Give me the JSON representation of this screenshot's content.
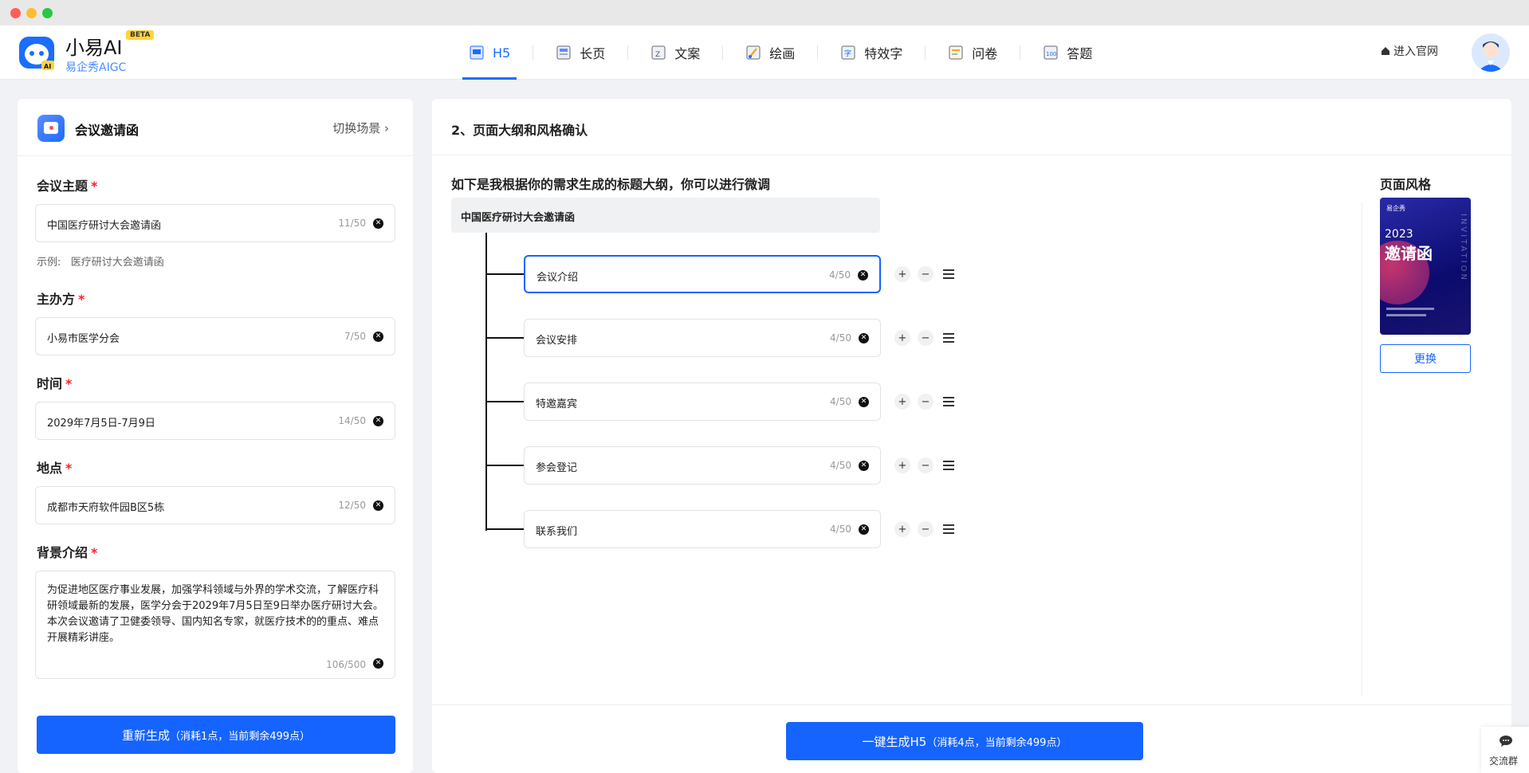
{
  "app": {
    "name": "小易AI",
    "badge": "BETA",
    "subtitle": "易企秀AIGC"
  },
  "nav": {
    "tabs": [
      {
        "label": "H5",
        "icon": "h5-icon",
        "active": true
      },
      {
        "label": "长页",
        "icon": "long-page-icon"
      },
      {
        "label": "文案",
        "icon": "copywriting-icon"
      },
      {
        "label": "绘画",
        "icon": "painting-icon"
      },
      {
        "label": "特效字",
        "icon": "effect-text-icon"
      },
      {
        "label": "问卷",
        "icon": "survey-icon"
      },
      {
        "label": "答题",
        "icon": "quiz-icon"
      }
    ],
    "site_link": "进入官网"
  },
  "left": {
    "scene_title": "会议邀请函",
    "switch_label": "切换场景",
    "fields": [
      {
        "label": "会议主题",
        "value": "中国医疗研讨大会邀请函",
        "count": "11/50"
      },
      {
        "label": "主办方",
        "value": "小易市医学分会",
        "count": "7/50"
      },
      {
        "label": "时间",
        "value": "2029年7月5日-7月9日",
        "count": "14/50"
      },
      {
        "label": "地点",
        "value": "成都市天府软件园B区5栋",
        "count": "12/50"
      }
    ],
    "required_mark": "*",
    "example_label": "示例:",
    "example_text": "医疗研讨大会邀请函",
    "background": {
      "label": "背景介绍",
      "value": "为促进地区医疗事业发展，加强学科领域与外界的学术交流，了解医疗科研领域最新的发展，医学分会于2029年7月5日至9日举办医疗研讨大会。本次会议邀请了卫健委领导、国内知名专家，就医疗技术的的重点、难点开展精彩讲座。",
      "count": "106/500"
    },
    "regenerate_main": "重新生成",
    "regenerate_note": "（消耗1点，当前剩余499点）"
  },
  "right": {
    "step_title": "2、页面大纲和风格确认",
    "outline_hint": "如下是我根据你的需求生成的标题大纲，你可以进行微调",
    "root_title": "中国医疗研讨大会邀请函",
    "items": [
      {
        "value": "会议介绍",
        "count": "4/50",
        "focused": true
      },
      {
        "value": "会议安排",
        "count": "4/50"
      },
      {
        "value": "特邀嘉宾",
        "count": "4/50"
      },
      {
        "value": "参会登记",
        "count": "4/50"
      },
      {
        "value": "联系我们",
        "count": "4/50"
      }
    ],
    "style_label": "页面风格",
    "poster": {
      "brand": "易企秀",
      "year": "2023",
      "title": "邀请函",
      "vertical": "INVITATION"
    },
    "change_label": "更换",
    "generate_main": "一键生成H5",
    "generate_note": "（消耗4点，当前剩余499点）"
  },
  "float": {
    "group_label": "交流群"
  },
  "colors": {
    "accent": "#1664ff",
    "required": "#f5222d"
  }
}
